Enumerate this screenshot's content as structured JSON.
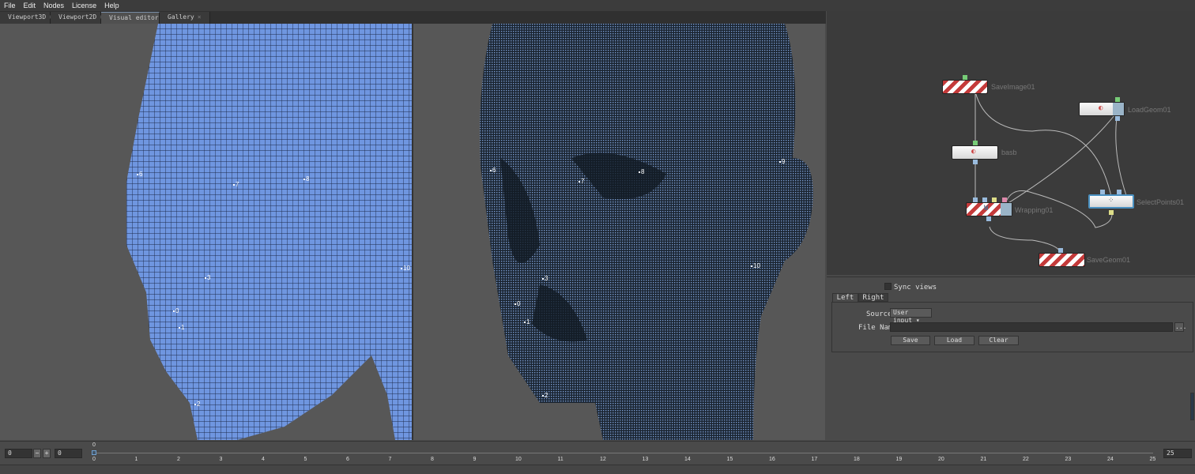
{
  "menu": [
    "File",
    "Edit",
    "Nodes",
    "License",
    "Help"
  ],
  "tabs": [
    {
      "label": "Viewport3D"
    },
    {
      "label": "Viewport2D"
    },
    {
      "label": "Visual editor",
      "active": true
    },
    {
      "label": "Gallery"
    }
  ],
  "viewport_left": {
    "landmarks": [
      "6",
      "7",
      "8",
      "3",
      "0",
      "1",
      "2",
      "10"
    ]
  },
  "viewport_right": {
    "landmarks": [
      "6",
      "7",
      "8",
      "9",
      "3",
      "0",
      "1",
      "2",
      "10"
    ]
  },
  "graph": {
    "nodes": [
      {
        "name": "SaveImage01",
        "style": "striped"
      },
      {
        "name": "LoadGeom01",
        "style": "white"
      },
      {
        "name": "basb",
        "style": "white"
      },
      {
        "name": "Wrapping01",
        "style": "striped"
      },
      {
        "name": "SelectPoints01",
        "style": "white",
        "selected": true
      },
      {
        "name": "SaveGeom01",
        "style": "striped"
      }
    ]
  },
  "props": {
    "sync_label": "Sync views",
    "sync_checked": false,
    "tabs": [
      "Left",
      "Right"
    ],
    "source_label": "Source",
    "source_value": "User input",
    "file_label": "File Name",
    "file_value": "",
    "browse": "...",
    "buttons": [
      "Save",
      "Load",
      "Clear"
    ]
  },
  "timeline": {
    "start": "0",
    "current": "0",
    "end": "25",
    "marker": "0",
    "ticks": [
      "0",
      "1",
      "2",
      "3",
      "4",
      "5",
      "6",
      "7",
      "8",
      "9",
      "10",
      "11",
      "12",
      "13",
      "14",
      "15",
      "16",
      "17",
      "18",
      "19",
      "20",
      "21",
      "22",
      "23",
      "24",
      "25"
    ],
    "minus": "−",
    "plus": "+"
  },
  "colors": {
    "accent": "#6fa0d0",
    "mesh": "#6f96e0",
    "scan": "#1a2430"
  }
}
